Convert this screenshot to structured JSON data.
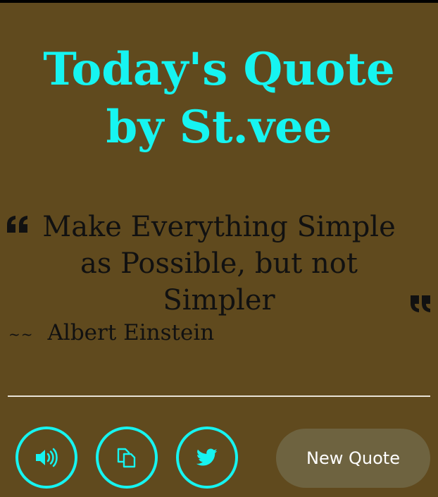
{
  "header": {
    "title_line1": "Today's Quote",
    "title_line2": "by St.vee"
  },
  "quote": {
    "text": "Make Everything Simple as Possible, but not Simpler",
    "author_prefix": "~~",
    "author": "Albert Einstein"
  },
  "actions": {
    "speak_icon": "speaker-icon",
    "copy_icon": "copy-icon",
    "tweet_icon": "twitter-icon",
    "new_quote_label": "New Quote"
  },
  "colors": {
    "background": "#604a1e",
    "accent": "#16f4f1",
    "text": "#111111",
    "button": "#6e6340"
  }
}
